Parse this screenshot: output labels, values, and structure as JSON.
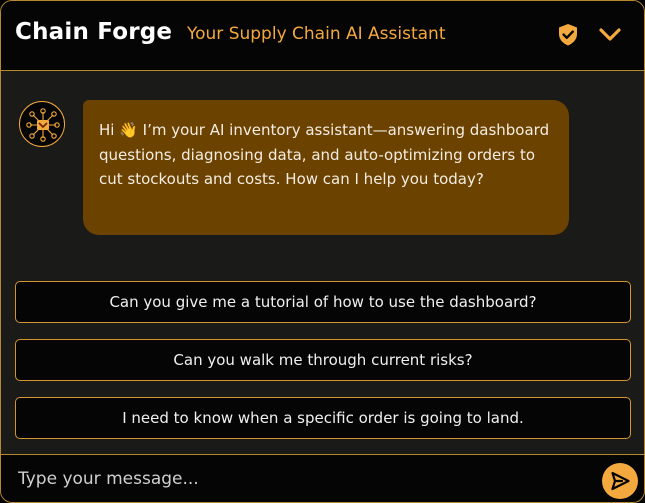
{
  "header": {
    "brand": "Chain Forge",
    "tagline": "Your Supply Chain AI Assistant",
    "shield_icon": "shield-check-icon",
    "collapse_icon": "chevron-down-icon"
  },
  "chat": {
    "bot_avatar_icon": "network-hub-icon",
    "greeting": "Hi 👋 I’m your AI inventory assistant—answering dashboard questions, diagnosing data, and auto-optimizing orders to cut stockouts and costs. How can I help you today?"
  },
  "suggestions": [
    "Can you give me a tutorial of how to use the dashboard?",
    "Can you walk me through current risks?",
    "I need to know when a specific order is going to land."
  ],
  "composer": {
    "placeholder": "Type your message...",
    "value": "",
    "send_icon": "send-arrow-icon"
  },
  "colors": {
    "accent": "#f4a93e",
    "border": "#b8882e",
    "bubble": "#6b4200",
    "header_bg": "#050505",
    "body_bg": "#1a1a18"
  }
}
